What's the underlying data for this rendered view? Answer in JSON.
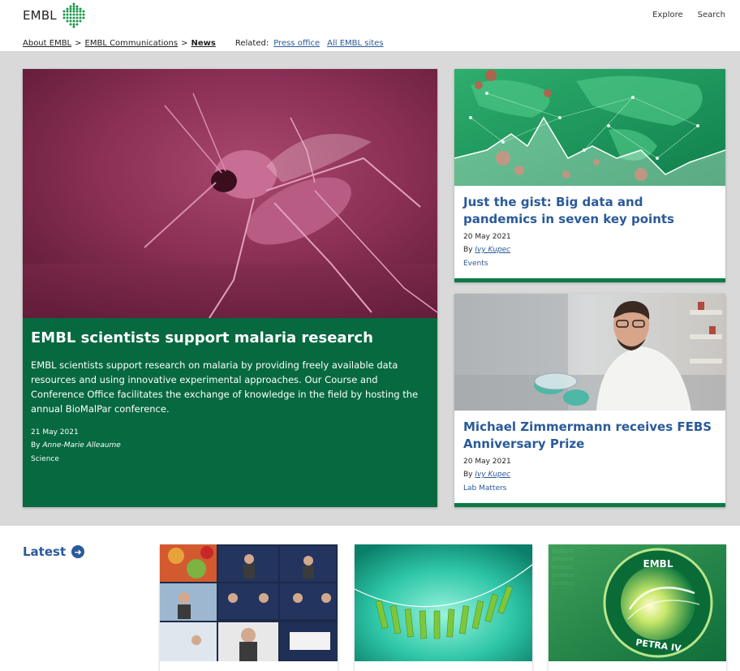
{
  "header": {
    "logo_text": "EMBL",
    "nav": [
      "Explore",
      "Search"
    ]
  },
  "breadcrumb": {
    "items": [
      "About EMBL",
      "EMBL Communications"
    ],
    "current": "News",
    "separator": ">",
    "related_label": "Related:",
    "related_links": [
      "Press office",
      "All EMBL sites"
    ]
  },
  "feature": {
    "image_icon": "mosquito-photo",
    "title": "EMBL scientists support malaria research",
    "summary": "EMBL scientists support research on malaria by providing freely available data resources and using innovative experimental approaches. Our Course and Conference Office facilitates the exchange of knowledge in the field by hosting the annual BioMalPar conference.",
    "date": "21 May 2021",
    "by_label": "By",
    "author": "Anne-Marie Alleaume",
    "tag": "Science"
  },
  "cards": [
    {
      "image_icon": "world-map-network-photo",
      "title": "Just the gist: Big data and pandemics in seven key points",
      "date": "20 May 2021",
      "by_label": "By",
      "author": "Ivy Kupec",
      "tag": "Events"
    },
    {
      "image_icon": "scientist-petri-dish-photo",
      "title": "Michael Zimmermann receives FEBS Anniversary Prize",
      "date": "20 May 2021",
      "by_label": "By",
      "author": "Ivy Kupec",
      "tag": "Lab Matters"
    }
  ],
  "latest": {
    "label": "Latest",
    "arrow_icon": "arrow-right-circle-icon",
    "thumbnails": [
      {
        "image_icon": "video-conference-grid-photo"
      },
      {
        "image_icon": "clothespins-photo"
      },
      {
        "image_icon": "petra-iv-logo-graphic",
        "logo_top": "EMBL",
        "logo_bottom": "PETRA IV"
      }
    ]
  },
  "colors": {
    "feature_green": "#06693f",
    "link_blue": "#2a5a9a",
    "card_border_green": "#0b7a45",
    "band_grey": "#d9d9d9"
  }
}
